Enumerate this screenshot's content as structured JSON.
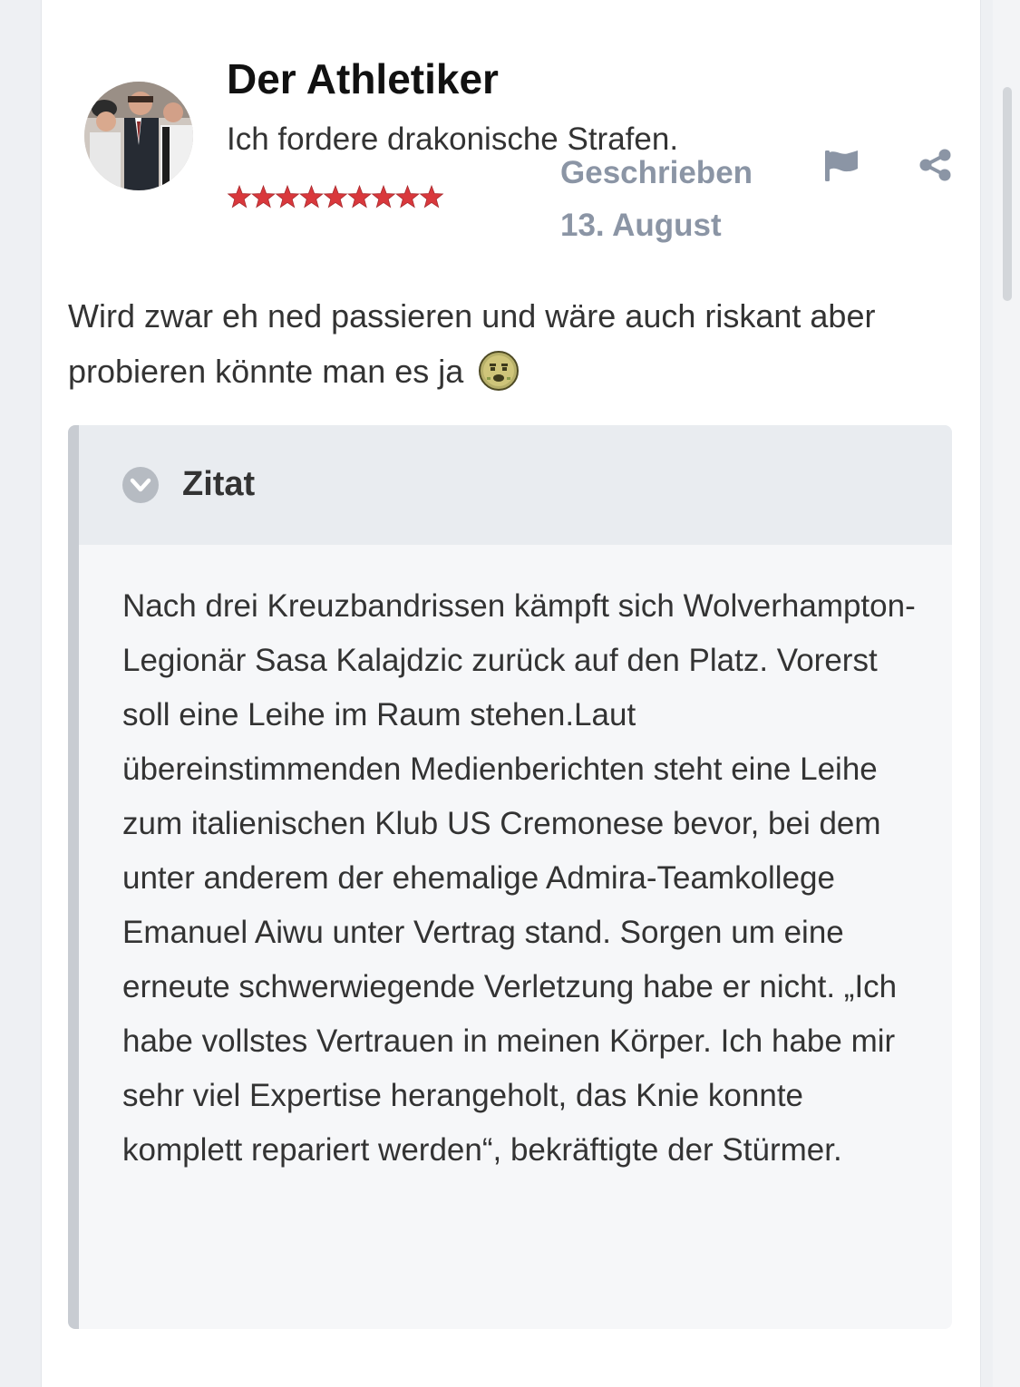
{
  "post": {
    "author_name": "Der Athletiker",
    "author_title": "Ich fordere drakonische Strafen.",
    "rank_stars": 9,
    "meta_label": "Geschrieben",
    "date": "13. August",
    "body_text": "Wird zwar eh ned passieren und wäre auch riskant aber probieren könnte man es ja",
    "body_emoji": "sick-face-emoji"
  },
  "quote": {
    "label": "Zitat",
    "text": "Nach drei Kreuzbandrissen kämpft sich Wolverhampton-Legionär Sasa Kalajdzic zurück auf den Platz. Vorerst soll eine Leihe im Raum stehen.Laut übereinstimmenden Medienberichten steht eine Leihe zum italienischen Klub US Cremonese bevor, bei dem unter anderem der ehemalige Admira-Teamkollege Emanuel Aiwu unter Vertrag stand. Sorgen um eine erneute schwerwiegende Verletzung habe er nicht. „Ich habe vollstes Vertrauen in meinen Körper. Ich habe mir sehr viel Expertise herangeholt, das Knie konnte komplett repariert werden“, bekräftigte der Stürmer."
  },
  "icons": {
    "report": "flag-icon",
    "share": "share-icon",
    "quote_toggle": "chevron-down-circle-icon"
  },
  "colors": {
    "meta_text": "#8b95a5",
    "star": "#d9383c",
    "quote_border": "#c8ccd2",
    "quote_header_bg": "#e9ecf0",
    "quote_bg": "#f6f7f9"
  }
}
